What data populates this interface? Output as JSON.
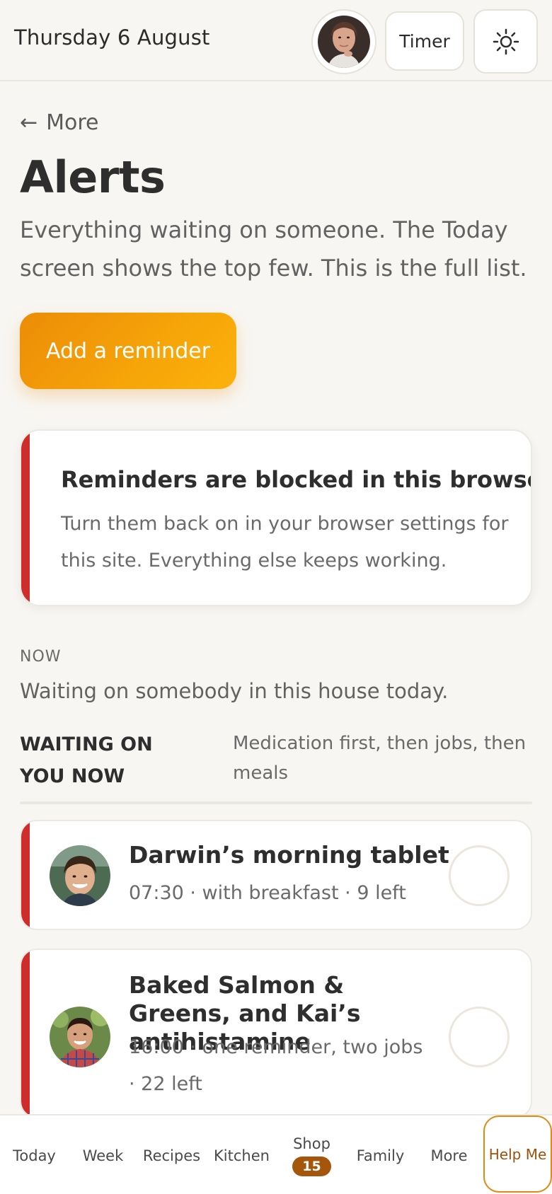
{
  "header": {
    "date": "Thursday 6 August",
    "timer_label": "Timer"
  },
  "nav_back": {
    "arrow": "←",
    "label": "More"
  },
  "page": {
    "title": "Alerts",
    "subtitle": "Everything waiting on someone. The Today screen shows the top few. This is the full list.",
    "add_button": "Add a reminder"
  },
  "warning": {
    "title": "Reminders are blocked in this browser",
    "body": "Turn them back on in your browser settings for this site. Everything else keeps working."
  },
  "section": {
    "kicker": "NOW",
    "description": "Waiting on somebody in this house today.",
    "group_title": "WAITING ON YOU NOW",
    "group_note": "Medication first, then jobs, then meals"
  },
  "tasks": [
    {
      "title": "Darwin’s morning tablet",
      "meta": "07:30 · with breakfast · 9 left"
    },
    {
      "title": "Baked Salmon & Greens, and Kai’s antihistamine",
      "meta": "16:00 · one reminder, two jobs · 22 left"
    }
  ],
  "bottom_nav": {
    "items": [
      "Today",
      "Week",
      "Recipes",
      "Kitchen",
      "Shop",
      "Family",
      "More"
    ],
    "shop_badge": "15",
    "help": "Help Me"
  },
  "colors": {
    "accent": "#f29a08",
    "alert": "#cf2c2c",
    "badge": "#a5560b",
    "background": "#f8f6f2"
  },
  "icons": [
    "user-avatar",
    "sun-icon",
    "back-arrow-icon",
    "check-circle"
  ]
}
